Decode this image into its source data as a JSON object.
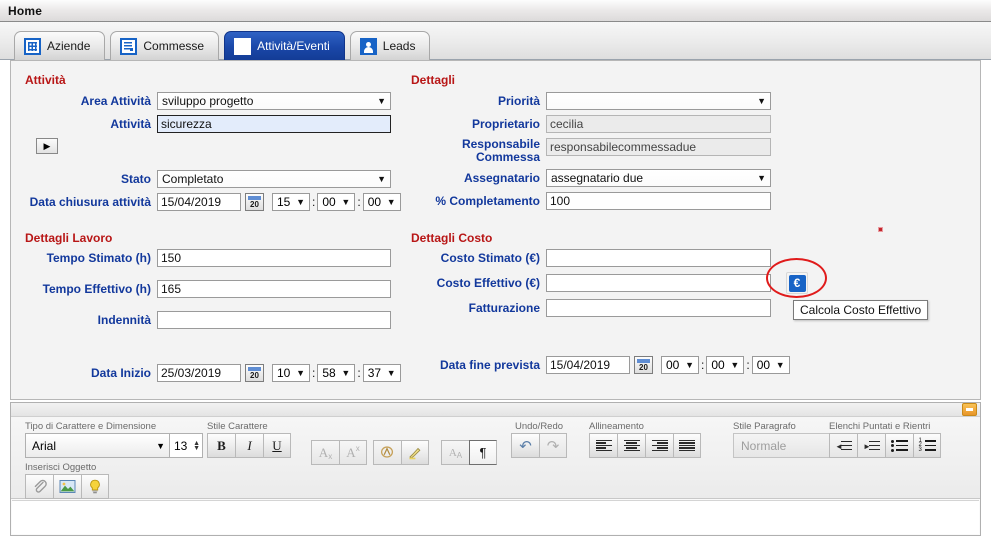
{
  "window": {
    "title": "Home"
  },
  "tabs": [
    {
      "label": "Aziende",
      "icon": "building-grid-icon",
      "active": false
    },
    {
      "label": "Commesse",
      "icon": "document-list-icon",
      "active": false
    },
    {
      "label": "Attività/Eventi",
      "icon": "calendar-icon",
      "active": true
    },
    {
      "label": "Leads",
      "icon": "person-icon",
      "active": false
    }
  ],
  "attivita": {
    "section_title": "Attività",
    "area_label": "Area Attività",
    "area_value": "sviluppo progetto",
    "attivita_label": "Attività",
    "attivita_value": "sicurezza",
    "expand_arrow": "▶",
    "stato_label": "Stato",
    "stato_value": "Completato",
    "data_chiusura_label": "Data chiusura attività",
    "data_chiusura_value": "15/04/2019",
    "ora": "15",
    "minuti": "00",
    "secondi": "00",
    "calendar_day": "20"
  },
  "dettagli": {
    "section_title": "Dettagli",
    "priorita_label": "Priorità",
    "priorita_value": "",
    "proprietario_label": "Proprietario",
    "proprietario_value": "cecilia",
    "responsabile_label_1": "Responsabile",
    "responsabile_label_2": "Commessa",
    "responsabile_value": "responsabilecommessadue",
    "assegnatario_label": "Assegnatario",
    "assegnatario_value": "assegnatario due",
    "completamento_label": "% Completamento",
    "completamento_value": "100"
  },
  "dettagli_lavoro": {
    "section_title": "Dettagli Lavoro",
    "tempo_stimato_label": "Tempo Stimato (h)",
    "tempo_stimato_value": "150",
    "tempo_effettivo_label": "Tempo Effettivo (h)",
    "tempo_effettivo_value": "165",
    "indennita_label": "Indennità",
    "indennita_value": "",
    "data_inizio_label": "Data Inizio",
    "data_inizio_value": "25/03/2019",
    "ora": "10",
    "minuti": "58",
    "secondi": "37",
    "calendar_day": "20"
  },
  "dettagli_costo": {
    "section_title": "Dettagli Costo",
    "costo_stimato_label": "Costo Stimato (€)",
    "costo_stimato_value": "",
    "costo_effettivo_label": "Costo Effettivo (€)",
    "costo_effettivo_value": "",
    "fatturazione_label": "Fatturazione",
    "fatturazione_value": "",
    "euro_button_glyph": "€",
    "tooltip": "Calcola Costo Effettivo",
    "data_fine_label": "Data fine prevista",
    "data_fine_value": "15/04/2019",
    "ora": "00",
    "minuti": "00",
    "secondi": "00",
    "calendar_day": "20"
  },
  "annotation": {
    "highlight_color": "#e01b1b",
    "cursor_dot_color": "#c3262b"
  },
  "editor": {
    "collapse_label": "−",
    "groups": {
      "font": {
        "label": "Tipo di Carattere e Dimensione",
        "font_value": "Arial",
        "size_value": "13"
      },
      "char_style": {
        "label": "Stile Carattere",
        "bold": "B",
        "italic": "I",
        "underline": "U",
        "subscript": "Ax",
        "superscript": "Ax"
      },
      "color": {
        "text_color": "text-color-icon",
        "highlight": "highlighter-icon"
      },
      "case": {
        "change_case": "A",
        "pilcrow": "¶"
      },
      "undo_redo": {
        "label": "Undo/Redo",
        "undo": "↶",
        "redo": "↷"
      },
      "alignment": {
        "label": "Allineamento",
        "left": "align-left",
        "center": "align-center",
        "right": "align-right",
        "justify": "align-justify"
      },
      "paragraph": {
        "label": "Stile Paragrafo",
        "value": "Normale"
      },
      "lists": {
        "label": "Elenchi Puntati e Rientri",
        "indent_decrease": "indent-decrease",
        "indent_increase": "indent-increase",
        "bullet_list": "bullet-list",
        "numbered_list": "numbered-list",
        "numbers": [
          "1",
          "2",
          "3"
        ]
      },
      "insert": {
        "label": "Inserisci Oggetto",
        "attachment": "paperclip-icon",
        "image": "image-icon",
        "idea": "lightbulb-icon"
      }
    },
    "body_text": ""
  }
}
